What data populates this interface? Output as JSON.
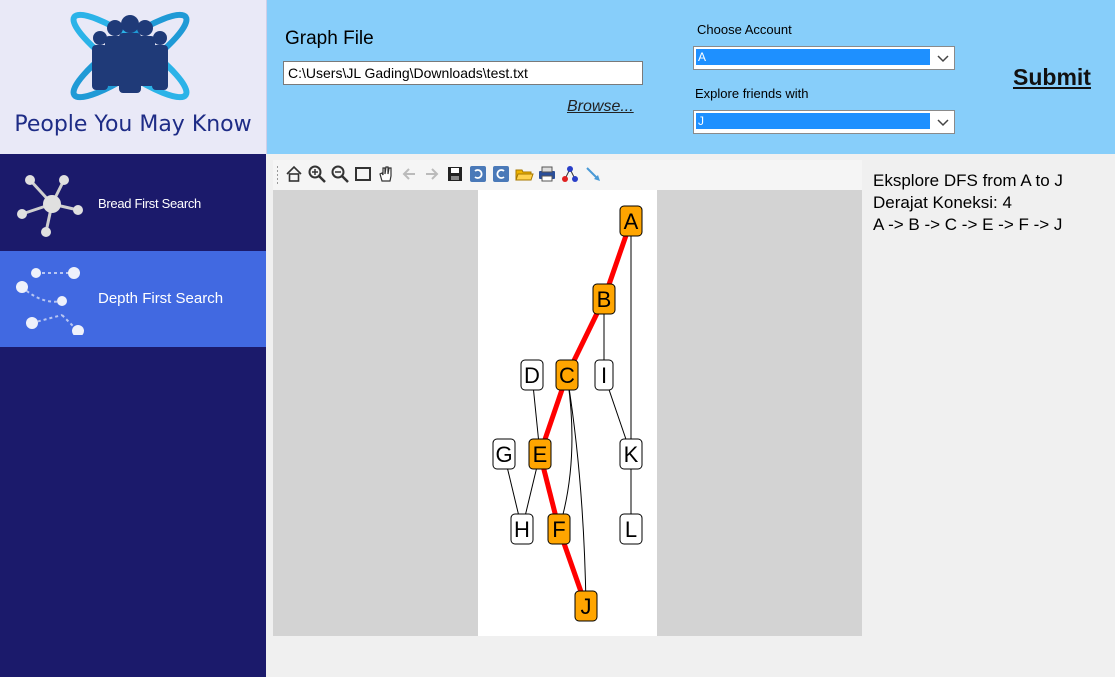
{
  "app": {
    "title": "People You May Know",
    "logo": "business-people-orbit-logo"
  },
  "sidebar": {
    "items": [
      {
        "label": "Bread First Search",
        "icon": "network-hub-icon",
        "active": false
      },
      {
        "label": "Depth First Search",
        "icon": "network-path-icon",
        "active": true
      }
    ]
  },
  "header": {
    "graph_file_label": "Graph File",
    "graph_file_path": "C:\\Users\\JL Gading\\Downloads\\test.txt",
    "browse_label": "Browse...",
    "choose_account_label": "Choose Account",
    "choose_account_value": "A",
    "explore_label": "Explore friends with",
    "explore_value": "J",
    "submit_label": "Submit"
  },
  "toolbar": {
    "icons": [
      "home-icon",
      "zoom-in-icon",
      "zoom-out-icon",
      "rectangle-select-icon",
      "pan-hand-icon",
      "back-arrow-icon",
      "forward-arrow-icon",
      "save-icon",
      "undo-icon",
      "redo-icon",
      "open-folder-icon",
      "print-icon",
      "layout-graph-icon",
      "edge-arrow-icon"
    ]
  },
  "graph": {
    "nodes": [
      {
        "id": "A",
        "highlighted": true
      },
      {
        "id": "B",
        "highlighted": true
      },
      {
        "id": "C",
        "highlighted": true
      },
      {
        "id": "D",
        "highlighted": false
      },
      {
        "id": "E",
        "highlighted": true
      },
      {
        "id": "F",
        "highlighted": true
      },
      {
        "id": "G",
        "highlighted": false
      },
      {
        "id": "H",
        "highlighted": false
      },
      {
        "id": "I",
        "highlighted": false
      },
      {
        "id": "J",
        "highlighted": true
      },
      {
        "id": "K",
        "highlighted": false
      },
      {
        "id": "L",
        "highlighted": false
      }
    ],
    "edges": [
      {
        "from": "A",
        "to": "B",
        "path": true
      },
      {
        "from": "B",
        "to": "C",
        "path": true
      },
      {
        "from": "C",
        "to": "E",
        "path": true
      },
      {
        "from": "E",
        "to": "F",
        "path": true
      },
      {
        "from": "F",
        "to": "J",
        "path": true
      },
      {
        "from": "A",
        "to": "K",
        "path": false
      },
      {
        "from": "B",
        "to": "I",
        "path": false
      },
      {
        "from": "I",
        "to": "K",
        "path": false
      },
      {
        "from": "K",
        "to": "L",
        "path": false
      },
      {
        "from": "D",
        "to": "E",
        "path": false
      },
      {
        "from": "G",
        "to": "H",
        "path": false
      },
      {
        "from": "E",
        "to": "H",
        "path": false
      },
      {
        "from": "C",
        "to": "F",
        "path": false
      },
      {
        "from": "C",
        "to": "J",
        "path": false
      }
    ],
    "colors": {
      "highlight_fill": "#ffa500",
      "path_edge": "#ff0000",
      "node_fill": "#ffffff",
      "edge": "#000000"
    }
  },
  "result": {
    "line1": "Eksplore DFS from A to J",
    "line2": "Derajat Koneksi: 4",
    "line3": "A -> B -> C -> E -> F -> J"
  }
}
